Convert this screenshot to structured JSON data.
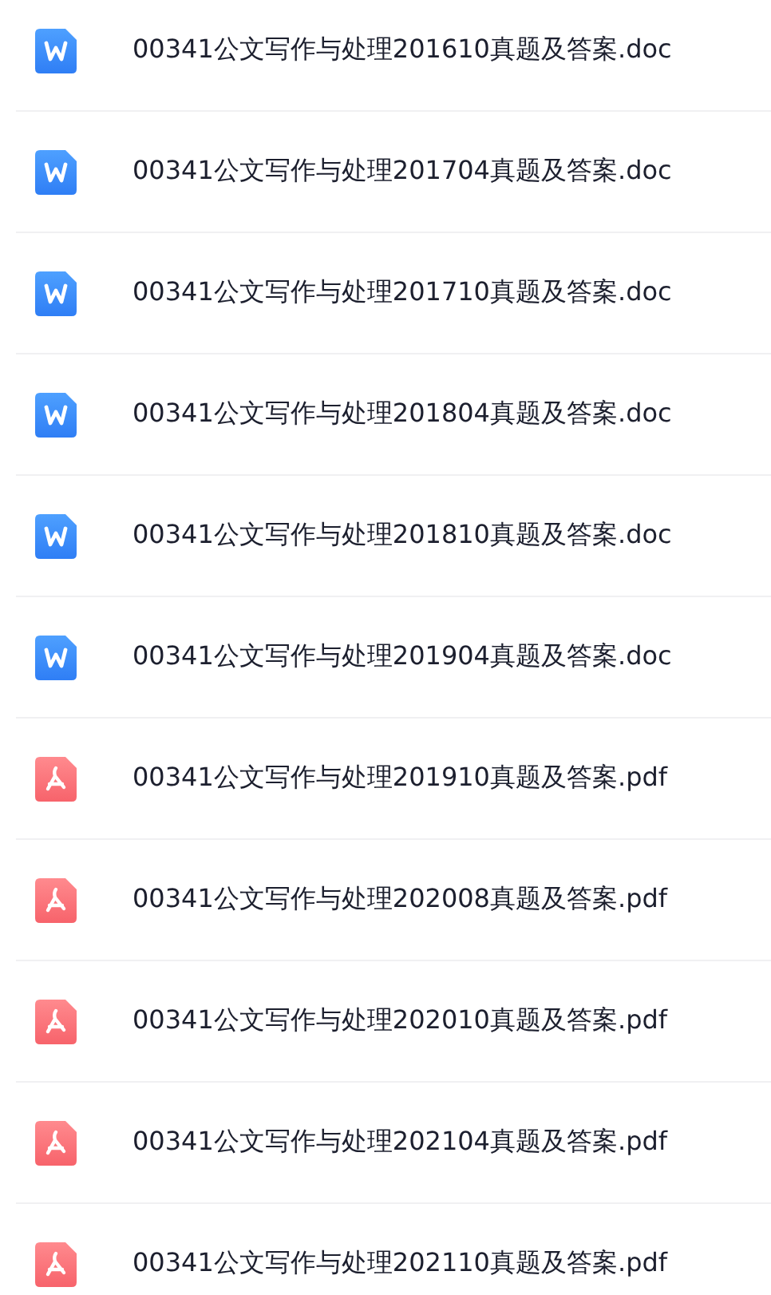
{
  "files": [
    {
      "kind": "doc",
      "name": "00341公文写作与处理201610真题及答案.doc"
    },
    {
      "kind": "doc",
      "name": "00341公文写作与处理201704真题及答案.doc"
    },
    {
      "kind": "doc",
      "name": "00341公文写作与处理201710真题及答案.doc"
    },
    {
      "kind": "doc",
      "name": "00341公文写作与处理201804真题及答案.doc"
    },
    {
      "kind": "doc",
      "name": "00341公文写作与处理201810真题及答案.doc"
    },
    {
      "kind": "doc",
      "name": "00341公文写作与处理201904真题及答案.doc"
    },
    {
      "kind": "pdf",
      "name": "00341公文写作与处理201910真题及答案.pdf"
    },
    {
      "kind": "pdf",
      "name": "00341公文写作与处理202008真题及答案.pdf"
    },
    {
      "kind": "pdf",
      "name": "00341公文写作与处理202010真题及答案.pdf"
    },
    {
      "kind": "pdf",
      "name": "00341公文写作与处理202104真题及答案.pdf"
    },
    {
      "kind": "pdf",
      "name": "00341公文写作与处理202110真题及答案.pdf"
    }
  ]
}
